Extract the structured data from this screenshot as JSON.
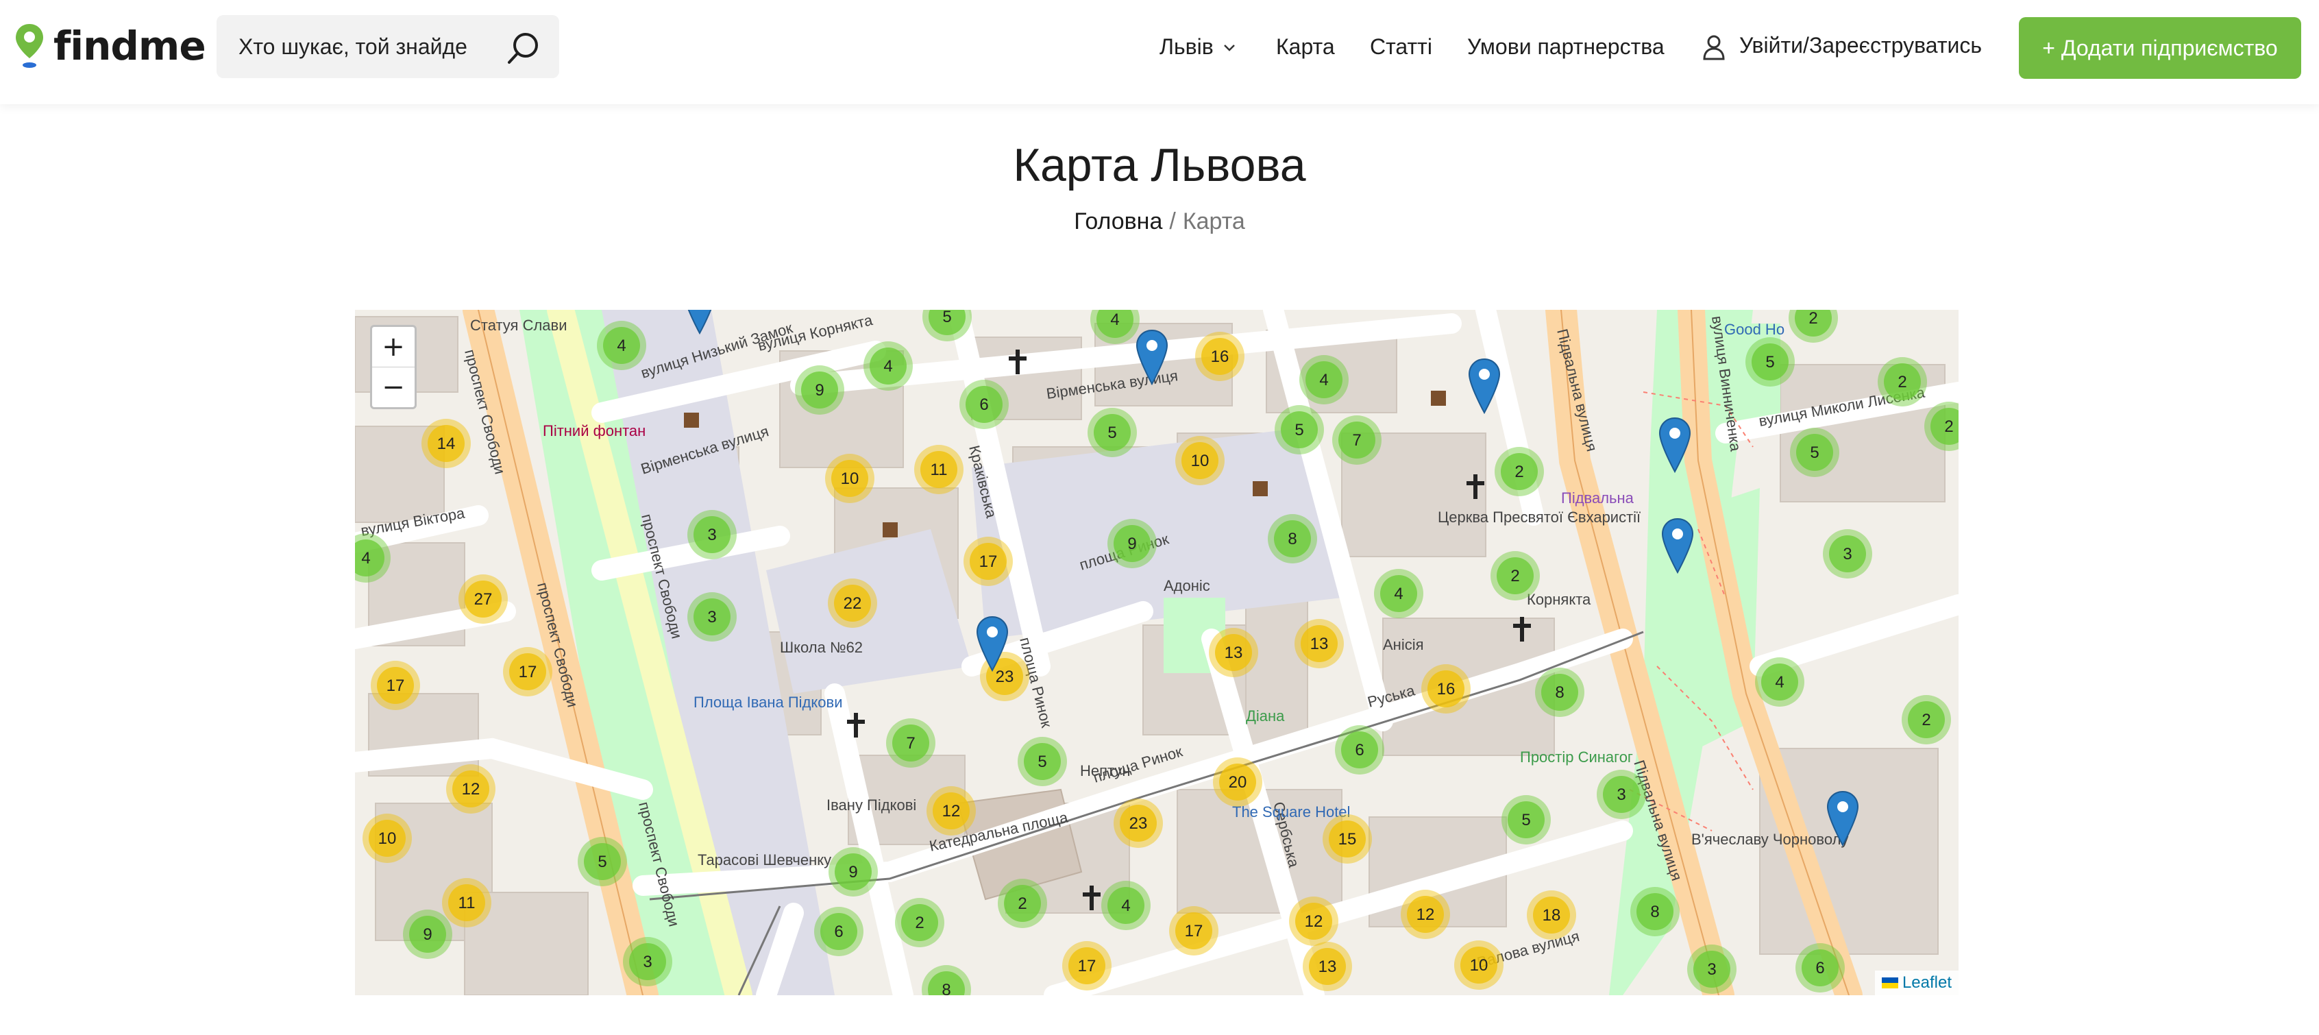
{
  "header": {
    "logo_text": "findme",
    "search_placeholder": "Хто шукає, той знайде",
    "nav": {
      "city": "Львів",
      "map": "Карта",
      "articles": "Статті",
      "partnership": "Умови партнерства",
      "login": "Увійти/Зареєструватись"
    },
    "add_button": "+ Додати підприємство"
  },
  "page": {
    "title": "Карта Львова",
    "breadcrumb_home": "Головна",
    "breadcrumb_sep": "/",
    "breadcrumb_current": "Карта"
  },
  "map": {
    "zoom_in": "+",
    "zoom_out": "−",
    "attribution": "Leaflet",
    "colors": {
      "cluster_small": "#6ecc39",
      "cluster_medium": "#f0c20c",
      "marker": "#2a81cb"
    },
    "street_labels": [
      "вулиця Низький Замок",
      "вулиця Корнякта",
      "Вірменська вулиця",
      "Вірменська вулиця",
      "проспект Свободи",
      "проспект Свободи",
      "проспект Свободи",
      "проспект Свободи",
      "Краківська",
      "площа Ринок",
      "площа Ринок",
      "площа Ринок",
      "Катедральна площа",
      "Руська",
      "Сербська",
      "Підвальна вулиця",
      "Підвальна вулиця",
      "вулиця Винниченка",
      "вулиця Миколи Лисенка",
      "Валова вулиця",
      "вулиця Віктора",
      "Площа Івана Підкови",
      "Івану Підкові",
      "Тарасові Шевченку",
      "Школа №62",
      "Церква Пресвятої Євхаристії",
      "Пітний фонтан",
      "Статуя Слави",
      "Адоніс",
      "Анісія",
      "Нептун",
      "The Square Hotel",
      "Простір Синагог",
      "В'ячеславу Чорноволу",
      "Good Ho",
      "Діана",
      "Корнякта",
      "Підвальна"
    ],
    "clusters": [
      {
        "n": "4"
      },
      {
        "n": "5"
      },
      {
        "n": "4"
      },
      {
        "n": "16"
      },
      {
        "n": "4"
      },
      {
        "n": "2"
      },
      {
        "n": "5"
      },
      {
        "n": "2"
      },
      {
        "n": "9"
      },
      {
        "n": "4"
      },
      {
        "n": "6"
      },
      {
        "n": "14"
      },
      {
        "n": "5"
      },
      {
        "n": "5"
      },
      {
        "n": "7"
      },
      {
        "n": "2"
      },
      {
        "n": "5"
      },
      {
        "n": "2"
      },
      {
        "n": "10"
      },
      {
        "n": "11"
      },
      {
        "n": "10"
      },
      {
        "n": "3"
      },
      {
        "n": "17"
      },
      {
        "n": "9"
      },
      {
        "n": "8"
      },
      {
        "n": "4"
      },
      {
        "n": "27"
      },
      {
        "n": "22"
      },
      {
        "n": "2"
      },
      {
        "n": "4"
      },
      {
        "n": "3"
      },
      {
        "n": "3"
      },
      {
        "n": "17"
      },
      {
        "n": "17"
      },
      {
        "n": "23"
      },
      {
        "n": "13"
      },
      {
        "n": "4"
      },
      {
        "n": "8"
      },
      {
        "n": "13"
      },
      {
        "n": "16"
      },
      {
        "n": "7"
      },
      {
        "n": "5"
      },
      {
        "n": "6"
      },
      {
        "n": "2"
      },
      {
        "n": "12"
      },
      {
        "n": "12"
      },
      {
        "n": "20"
      },
      {
        "n": "23"
      },
      {
        "n": "15"
      },
      {
        "n": "5"
      },
      {
        "n": "3"
      },
      {
        "n": "10"
      },
      {
        "n": "5"
      },
      {
        "n": "11"
      },
      {
        "n": "9"
      },
      {
        "n": "9"
      },
      {
        "n": "2"
      },
      {
        "n": "6"
      },
      {
        "n": "2"
      },
      {
        "n": "4"
      },
      {
        "n": "17"
      },
      {
        "n": "12"
      },
      {
        "n": "12"
      },
      {
        "n": "18"
      },
      {
        "n": "8"
      },
      {
        "n": "3"
      },
      {
        "n": "17"
      },
      {
        "n": "13"
      },
      {
        "n": "10"
      },
      {
        "n": "3"
      },
      {
        "n": "6"
      },
      {
        "n": "8"
      }
    ],
    "marker_count": 7
  }
}
